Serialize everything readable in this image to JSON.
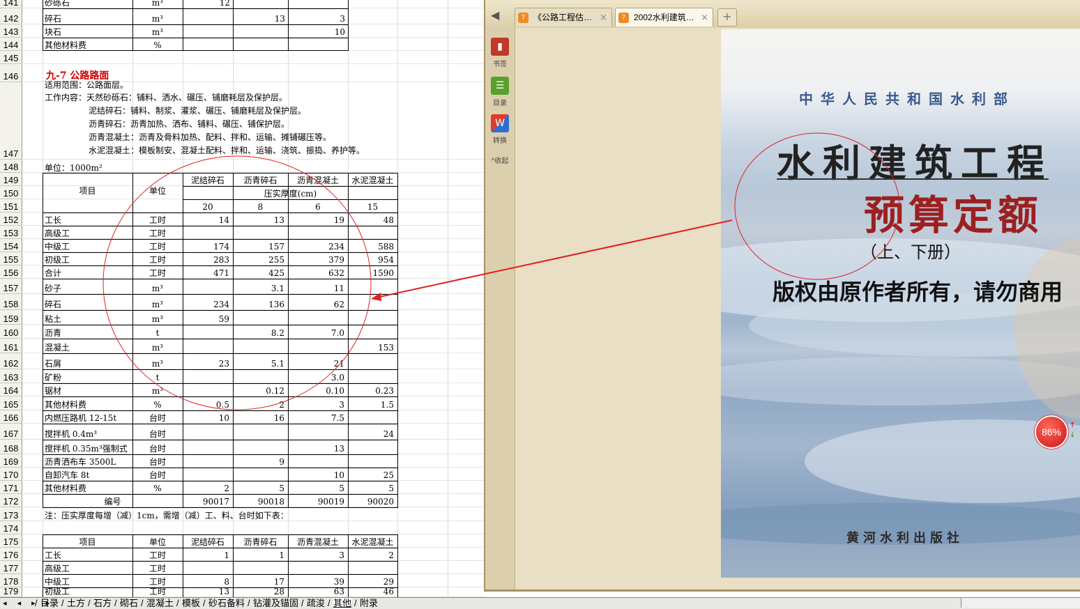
{
  "sheet": {
    "row_numbers": [
      "141",
      "142",
      "143",
      "144",
      "145",
      "146",
      "147",
      "148",
      "149",
      "150",
      "151",
      "152",
      "153",
      "154",
      "155",
      "156",
      "157",
      "158",
      "159",
      "160",
      "161",
      "162",
      "163",
      "164",
      "165",
      "166",
      "167",
      "168",
      "169",
      "170",
      "171",
      "172",
      "173",
      "174",
      "175",
      "176",
      "177",
      "178",
      "179"
    ],
    "top_rows": [
      {
        "item": "砂砾石",
        "unit": "m³",
        "v": [
          "12",
          "",
          "",
          ""
        ]
      },
      {
        "item": "碎石",
        "unit": "m³",
        "v": [
          "",
          "13",
          "3",
          ""
        ]
      },
      {
        "item": "块石",
        "unit": "m³",
        "v": [
          "",
          "",
          "10",
          ""
        ]
      },
      {
        "item": "其他材料费",
        "unit": "%",
        "v": [
          "",
          "",
          "",
          ""
        ]
      }
    ],
    "section_title": "九-7  公路路面",
    "scope": "适用范围：公路面层。",
    "work_lines": [
      "工作内容：天然砂砾石：铺料、洒水、碾压、铺磨耗层及保护层。",
      "泥结碎石：铺料、制浆、灌浆、碾压、铺磨耗层及保护层。",
      "沥青碎石：沥青加热、洒布、铺料、碾压、铺保护层。",
      "沥青混凝土：沥青及骨料加热、配料、拌和、运输、摊铺碾压等。",
      "水泥混凝土：模板制安、混凝土配料、拌和、运输、浇筑、振捣、养护等。"
    ],
    "unit_label": "单位：1000m²",
    "table_headers": {
      "item": "项目",
      "unit": "单位",
      "cols": [
        "泥结碎石",
        "沥青碎石",
        "沥青混凝土",
        "水泥混凝土"
      ],
      "thickness": "压实厚度(cm)",
      "thick_vals": [
        "20",
        "8",
        "6",
        "15"
      ]
    },
    "rows": [
      {
        "item": "工长",
        "unit": "工时",
        "v": [
          "14",
          "13",
          "19",
          "48"
        ]
      },
      {
        "item": "高级工",
        "unit": "工时",
        "v": [
          "",
          "",
          "",
          ""
        ]
      },
      {
        "item": "中级工",
        "unit": "工时",
        "v": [
          "174",
          "157",
          "234",
          "588"
        ]
      },
      {
        "item": "初级工",
        "unit": "工时",
        "v": [
          "283",
          "255",
          "379",
          "954"
        ]
      },
      {
        "item": "合计",
        "unit": "工时",
        "v": [
          "471",
          "425",
          "632",
          "1590"
        ]
      },
      {
        "item": "砂子",
        "unit": "m³",
        "v": [
          "",
          "3.1",
          "11",
          ""
        ]
      },
      {
        "item": "碎石",
        "unit": "m³",
        "v": [
          "234",
          "136",
          "62",
          ""
        ]
      },
      {
        "item": "粘土",
        "unit": "m³",
        "v": [
          "59",
          "",
          "",
          ""
        ]
      },
      {
        "item": "沥青",
        "unit": "t",
        "v": [
          "",
          "8.2",
          "7.0",
          ""
        ]
      },
      {
        "item": "混凝土",
        "unit": "m³",
        "v": [
          "",
          "",
          "",
          "153"
        ]
      },
      {
        "item": "石屑",
        "unit": "m³",
        "v": [
          "23",
          "5.1",
          "21",
          ""
        ]
      },
      {
        "item": "矿粉",
        "unit": "t",
        "v": [
          "",
          "",
          "3.0",
          ""
        ]
      },
      {
        "item": "锯材",
        "unit": "m³",
        "v": [
          "",
          "0.12",
          "0.10",
          "0.23"
        ]
      },
      {
        "item": "其他材料费",
        "unit": "%",
        "v": [
          "0.5",
          "2",
          "3",
          "1.5"
        ]
      },
      {
        "item": "内燃压路机  12-15t",
        "unit": "台时",
        "v": [
          "10",
          "16",
          "7.5",
          ""
        ]
      },
      {
        "item": "搅拌机  0.4m³",
        "unit": "台时",
        "v": [
          "",
          "",
          "",
          "24"
        ]
      },
      {
        "item": "搅拌机 0.35m³强制式",
        "unit": "台时",
        "v": [
          "",
          "",
          "13",
          ""
        ]
      },
      {
        "item": "沥青洒布车  3500L",
        "unit": "台时",
        "v": [
          "",
          "9",
          "",
          ""
        ]
      },
      {
        "item": "自卸汽车  8t",
        "unit": "台时",
        "v": [
          "",
          "",
          "10",
          "25"
        ]
      },
      {
        "item": "其他材料费",
        "unit": "%",
        "v": [
          "2",
          "5",
          "5",
          "5"
        ]
      }
    ],
    "code_row": {
      "label": "编号",
      "v": [
        "90017",
        "90018",
        "90019",
        "90020"
      ]
    },
    "note": "注：压实厚度每增（减）1cm，需增（减）工、料、台时如下表：",
    "table2_headers": {
      "item": "项目",
      "unit": "单位",
      "cols": [
        "泥结碎石",
        "沥青碎石",
        "沥青混凝土",
        "水泥混凝土"
      ]
    },
    "table2_rows": [
      {
        "item": "工长",
        "unit": "工时",
        "v": [
          "1",
          "1",
          "3",
          "2"
        ]
      },
      {
        "item": "高级工",
        "unit": "工时",
        "v": [
          "",
          "",
          "",
          ""
        ]
      },
      {
        "item": "中级工",
        "unit": "工时",
        "v": [
          "8",
          "17",
          "39",
          "29"
        ]
      },
      {
        "item": "初级工",
        "unit": "工时",
        "v": [
          "13",
          "28",
          "63",
          "46"
        ]
      }
    ]
  },
  "sheet_tabs": {
    "nav": "◂ ◂ ▸ ▸",
    "tabs": [
      "目录",
      "土方",
      "石方",
      "砌石",
      "混凝土",
      "模板",
      "砂石备料",
      "钻灌及锚固",
      "疏浚",
      "其他",
      "附录"
    ],
    "active": "其他"
  },
  "reader": {
    "tabs": [
      {
        "title": "《公路工程估…",
        "close": "×"
      },
      {
        "title": "2002水利建筑…",
        "close": "×"
      }
    ],
    "new_tab": "+",
    "back": "◀",
    "side": {
      "bookmark": "书签",
      "toc": "目录",
      "convert": "转换",
      "collapse": "收起"
    },
    "cover": {
      "publisher_top": "中华人民共和国水利部",
      "title1": "水利建筑工程",
      "title2": "预算定额",
      "volume": "（上、下册）",
      "copyright": "版权由原作者所有，请勿商用",
      "press": "黄河水利出版社"
    }
  },
  "zoom": {
    "label": "86%"
  },
  "colors": {
    "title_red": "#c00000",
    "annotation_red": "#e02020",
    "zoom_red": "#d8151f",
    "reader_bg": "#e4d8b9"
  }
}
